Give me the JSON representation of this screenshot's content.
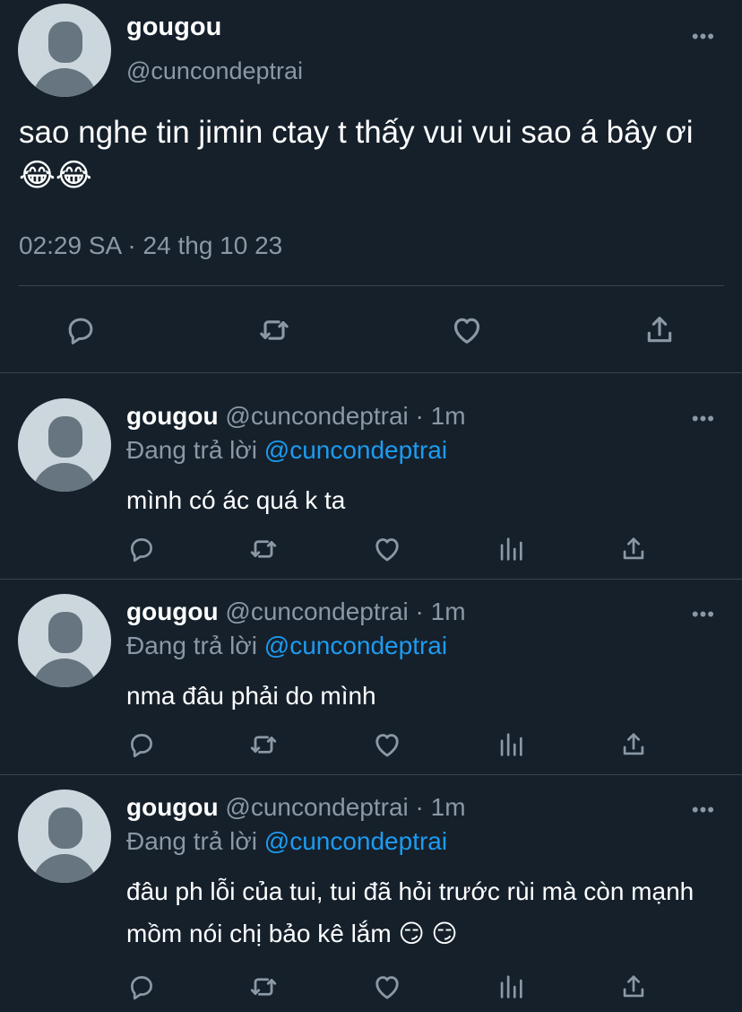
{
  "main_tweet": {
    "display_name": "gougou",
    "handle": "@cuncondeptrai",
    "text": "sao nghe tin jimin ctay t thấy vui vui sao á bây ơi 😂😂",
    "timestamp": "02:29 SA · 24 thg 10 23",
    "more_label": "•••",
    "actions": [
      "reply-icon",
      "retweet-icon",
      "like-icon",
      "share-icon"
    ]
  },
  "replies": [
    {
      "display_name": "gougou",
      "handle": "@cuncondeptrai · 1m",
      "replying_prefix": "Đang trả lời ",
      "replying_to": "@cuncondeptrai",
      "text": "mình có ác quá k ta",
      "more_label": "•••"
    },
    {
      "display_name": "gougou",
      "handle": "@cuncondeptrai · 1m",
      "replying_prefix": "Đang trả lời ",
      "replying_to": "@cuncondeptrai",
      "text": "nma đâu phải do mình",
      "more_label": "•••"
    },
    {
      "display_name": "gougou",
      "handle": "@cuncondeptrai · 1m",
      "replying_prefix": "Đang trả lời ",
      "replying_to": "@cuncondeptrai",
      "text": "đâu ph lỗi của tui, tui đã hỏi trước rùi mà còn mạnh mồm nói chị bảo kê lắm 😏 😏",
      "more_label": "•••"
    }
  ],
  "colors": {
    "background": "#15202b",
    "secondary_text": "#8b98a5",
    "mention": "#1d9bf0",
    "divider": "#38444d"
  }
}
